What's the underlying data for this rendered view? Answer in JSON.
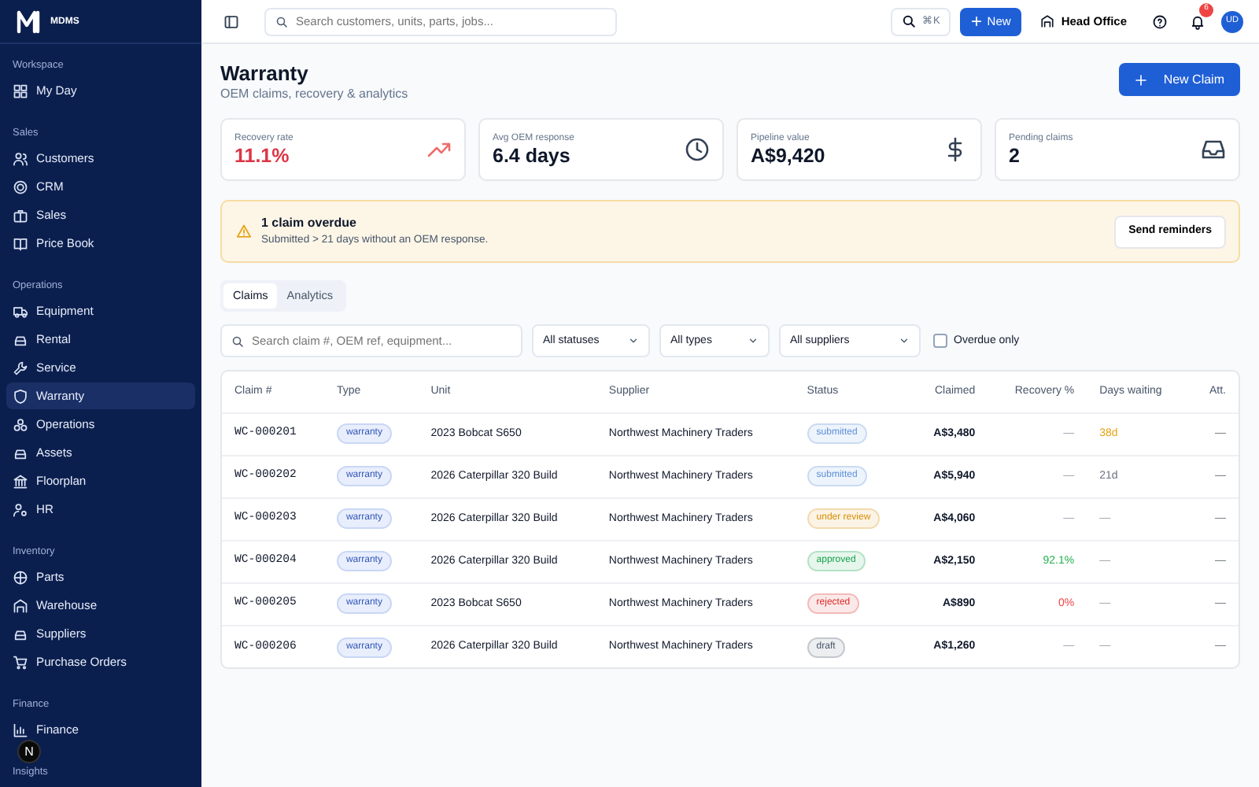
{
  "brand": {
    "name": "MDMS"
  },
  "sidebar": {
    "sections": [
      {
        "label": "Workspace",
        "items": [
          {
            "label": "My Day",
            "selected": false
          }
        ]
      },
      {
        "label": "Sales",
        "items": [
          {
            "label": "Customers",
            "selected": false
          },
          {
            "label": "CRM",
            "selected": false
          },
          {
            "label": "Sales",
            "selected": false
          },
          {
            "label": "Price Book",
            "selected": false
          }
        ]
      },
      {
        "label": "Operations",
        "items": [
          {
            "label": "Equipment",
            "selected": false
          },
          {
            "label": "Rental",
            "selected": false
          },
          {
            "label": "Service",
            "selected": false
          },
          {
            "label": "Warranty",
            "selected": true
          },
          {
            "label": "Operations",
            "selected": false
          },
          {
            "label": "Assets",
            "selected": false
          },
          {
            "label": "Floorplan",
            "selected": false
          },
          {
            "label": "HR",
            "selected": false
          }
        ]
      },
      {
        "label": "Inventory",
        "items": [
          {
            "label": "Parts",
            "selected": false
          },
          {
            "label": "Warehouse",
            "selected": false
          },
          {
            "label": "Suppliers",
            "selected": false
          },
          {
            "label": "Purchase Orders",
            "selected": false
          }
        ]
      },
      {
        "label": "Finance",
        "items": [
          {
            "label": "Finance",
            "selected": false
          }
        ]
      },
      {
        "label": "Insights"
      }
    ]
  },
  "dev_badge": "N",
  "topbar": {
    "search_placeholder": "Search customers, units, parts, jobs...",
    "shortcut": "⌘K",
    "new_button": "New",
    "branch": "Head Office",
    "notifications": "6",
    "avatar": "UD"
  },
  "page": {
    "title": "Warranty",
    "subtitle": "OEM claims, recovery & analytics",
    "action": "New Claim"
  },
  "kpis": [
    {
      "label": "Recovery rate",
      "value": "11.1%",
      "color": "#dc3545"
    },
    {
      "label": "Avg OEM response",
      "value": "6.4 days",
      "color": "#0f172a"
    },
    {
      "label": "Pipeline value",
      "value": "A$9,420",
      "color": "#0f172a"
    },
    {
      "label": "Pending claims",
      "value": "2",
      "color": "#0f172a"
    }
  ],
  "alert": {
    "title": "1 claim overdue",
    "text": "Submitted > 21 days without an OEM response.",
    "button": "Send reminders"
  },
  "tabs": [
    {
      "label": "Claims",
      "selected": true
    },
    {
      "label": "Analytics",
      "selected": false
    }
  ],
  "filters": {
    "search_placeholder": "Search claim #, OEM ref, equipment...",
    "selects": [
      "All statuses",
      "All types",
      "All suppliers"
    ],
    "overdue_only": {
      "label": "Overdue only",
      "checked": false
    }
  },
  "table": {
    "columns": [
      "Claim #",
      "Type",
      "Unit",
      "Supplier",
      "Status",
      "Claimed",
      "Recovery %",
      "Days waiting",
      "Att."
    ],
    "rows": [
      {
        "claim": "WC-000201",
        "type": "warranty",
        "unit": "2023 Bobcat S650",
        "supplier": "Northwest Machinery Traders",
        "status": {
          "label": "submitted",
          "color": "#5b8fd9"
        },
        "claimed": "A$3,480",
        "recovery": {
          "text": "—",
          "color": "#9ca3af"
        },
        "days": {
          "text": "38d",
          "color": "#e6a417"
        },
        "att": "—"
      },
      {
        "claim": "WC-000202",
        "type": "warranty",
        "unit": "2026 Caterpillar 320 Build",
        "supplier": "Northwest Machinery Traders",
        "status": {
          "label": "submitted",
          "color": "#5b8fd9"
        },
        "claimed": "A$5,940",
        "recovery": {
          "text": "—",
          "color": "#9ca3af"
        },
        "days": {
          "text": "21d",
          "color": "#6b7280"
        },
        "att": "—"
      },
      {
        "claim": "WC-000203",
        "type": "warranty",
        "unit": "2026 Caterpillar 320 Build",
        "supplier": "Northwest Machinery Traders",
        "status": {
          "label": "under review",
          "color": "#d98e04"
        },
        "claimed": "A$4,060",
        "recovery": {
          "text": "—",
          "color": "#9ca3af"
        },
        "days": {
          "text": "—",
          "color": "#9ca3af"
        },
        "att": "—"
      },
      {
        "claim": "WC-000204",
        "type": "warranty",
        "unit": "2026 Caterpillar 320 Build",
        "supplier": "Northwest Machinery Traders",
        "status": {
          "label": "approved",
          "color": "#16a34a"
        },
        "claimed": "A$2,150",
        "recovery": {
          "text": "92.1%",
          "color": "#22b04b"
        },
        "days": {
          "text": "—",
          "color": "#9ca3af"
        },
        "att": "—"
      },
      {
        "claim": "WC-000205",
        "type": "warranty",
        "unit": "2023 Bobcat S650",
        "supplier": "Northwest Machinery Traders",
        "status": {
          "label": "rejected",
          "color": "#dc2626"
        },
        "claimed": "A$890",
        "recovery": {
          "text": "0%",
          "color": "#ef4444"
        },
        "days": {
          "text": "—",
          "color": "#9ca3af"
        },
        "att": "—"
      },
      {
        "claim": "WC-000206",
        "type": "warranty",
        "unit": "2026 Caterpillar 320 Build",
        "supplier": "Northwest Machinery Traders",
        "status": {
          "label": "draft",
          "color": "#475569"
        },
        "claimed": "A$1,260",
        "recovery": {
          "text": "—",
          "color": "#9ca3af"
        },
        "days": {
          "text": "—",
          "color": "#9ca3af"
        },
        "att": "—"
      }
    ]
  }
}
